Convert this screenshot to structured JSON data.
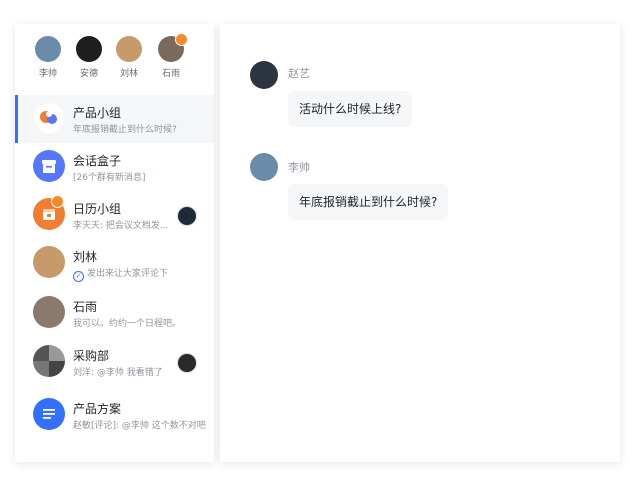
{
  "favorites": [
    {
      "name": "李帅",
      "color": "#6a8ca8",
      "badge": false
    },
    {
      "name": "安德",
      "color": "#1e1e1e",
      "badge": false
    },
    {
      "name": "刘林",
      "color": "#c79a6a",
      "badge": false
    },
    {
      "name": "石雨",
      "color": "#7a6a5e",
      "badge": true
    }
  ],
  "chats": [
    {
      "title": "产品小组",
      "subtitle": "年底报销截止到什么时候?",
      "active": true,
      "icon": "group-avatar-icon",
      "color": "#f07d33"
    },
    {
      "title": "会话盒子",
      "subtitle": "[26个群有新消息]",
      "icon": "archive-box-icon",
      "color": "#5677fc"
    },
    {
      "title": "日历小组",
      "subtitle": "李天天: 把会议文档发...",
      "icon": "calendar-icon",
      "color": "#f07d33"
    },
    {
      "title": "刘林",
      "subtitle": "发出来让大家评论下",
      "icon": "person-avatar",
      "color": "#c79a6a"
    },
    {
      "title": "石雨",
      "subtitle": "我可以。约约一个日程吧。",
      "icon": "person-avatar",
      "color": "#8a7a6e"
    },
    {
      "title": "采购部",
      "subtitle": "刘洋: @李帅 我看错了",
      "icon": "group-avatar-icon",
      "color": "#555555"
    },
    {
      "title": "产品方案",
      "subtitle": "赵敏[评论]: @李帅 这个数不对吧",
      "icon": "document-icon",
      "color": "#3370ff"
    }
  ],
  "messages": [
    {
      "sender": "赵艺",
      "text": "活动什么时候上线?"
    },
    {
      "sender": "李帅",
      "text": "年底报销截止到什么时候?"
    }
  ]
}
